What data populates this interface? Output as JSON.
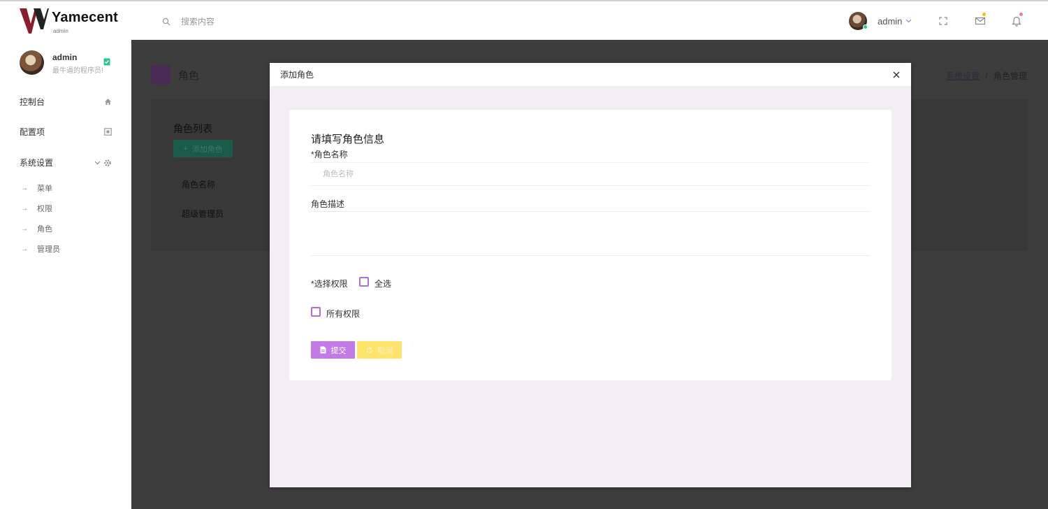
{
  "header": {
    "logo_text": "Yamecent",
    "logo_sub": "admin",
    "search_placeholder": "搜索内容",
    "user_name": "admin"
  },
  "sidebar": {
    "profile": {
      "name": "admin",
      "description": "最牛逼的程序员!"
    },
    "nav": [
      {
        "label": "控制台",
        "icon": "home-icon"
      },
      {
        "label": "配置项",
        "icon": "config-icon"
      },
      {
        "label": "系统设置",
        "icon": "gear-icon"
      }
    ],
    "sub_items": [
      "菜单",
      "权限",
      "角色",
      "管理员"
    ]
  },
  "page": {
    "title": "角色",
    "breadcrumb": {
      "link": "系统设置",
      "separator": "/",
      "current": "角色管理"
    },
    "list_title": "角色列表",
    "add_button": "添加角色",
    "table_header": "角色名称",
    "table_rows": [
      "超级管理员"
    ]
  },
  "modal": {
    "title": "添加角色",
    "form_title": "请填写角色信息",
    "name_label": "*角色名称",
    "name_placeholder": "角色名称",
    "desc_label": "角色描述",
    "perm_label": "*选择权限",
    "select_all": "全选",
    "all_permissions": "所有权限",
    "submit": "提交",
    "cancel": "取消"
  },
  "colors": {
    "accent_purple": "#c17ae6",
    "accent_yellow": "#ffe36a",
    "online_dot": "#2ec58e"
  }
}
